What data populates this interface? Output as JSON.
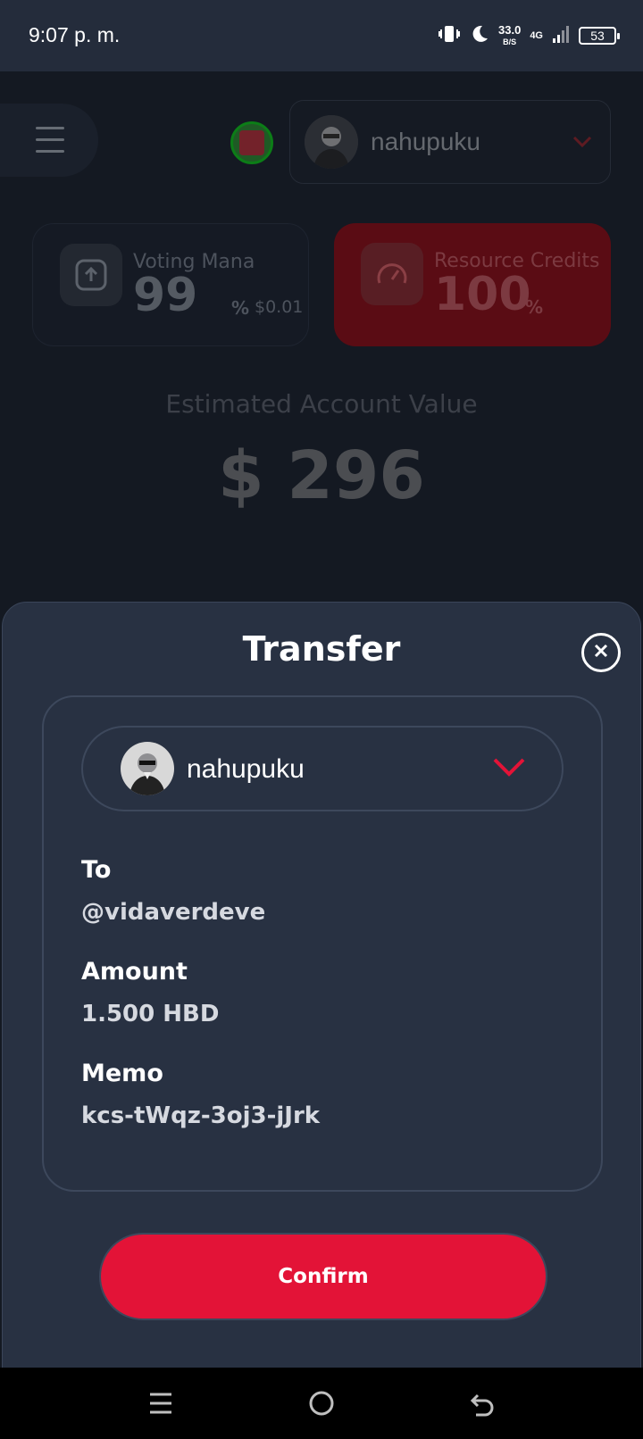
{
  "status_bar": {
    "time": "9:07 p. m.",
    "net_speed": "33.0",
    "net_unit": "B/S",
    "network": "4G",
    "battery": "53"
  },
  "background_app": {
    "account_name": "nahupuku",
    "voting_mana": {
      "label": "Voting Mana",
      "value": "99",
      "unit": "%",
      "usd": "$0.01"
    },
    "resource_credits": {
      "label": "Resource Credits",
      "value": "100",
      "unit": "%"
    },
    "estimated_label": "Estimated Account Value",
    "estimated_value": "$ 296"
  },
  "transfer_sheet": {
    "title": "Transfer",
    "account_name": "nahupuku",
    "to_label": "To",
    "to_value": "@vidaverdeve",
    "amount_label": "Amount",
    "amount_value": "1.500 HBD",
    "memo_label": "Memo",
    "memo_value": "kcs-tWqz-3oj3-jJrk",
    "confirm_label": "Confirm"
  },
  "colors": {
    "accent": "#e31337",
    "sheet_bg": "#283142",
    "rc_card": "#5a0c14"
  },
  "icons": [
    "vibrate-icon",
    "moon-icon",
    "signal-icon",
    "battery-icon",
    "menu-icon",
    "upload-icon",
    "gauge-icon",
    "close-icon",
    "chevron-down-icon",
    "nav-recents-icon",
    "nav-home-icon",
    "nav-back-icon"
  ]
}
